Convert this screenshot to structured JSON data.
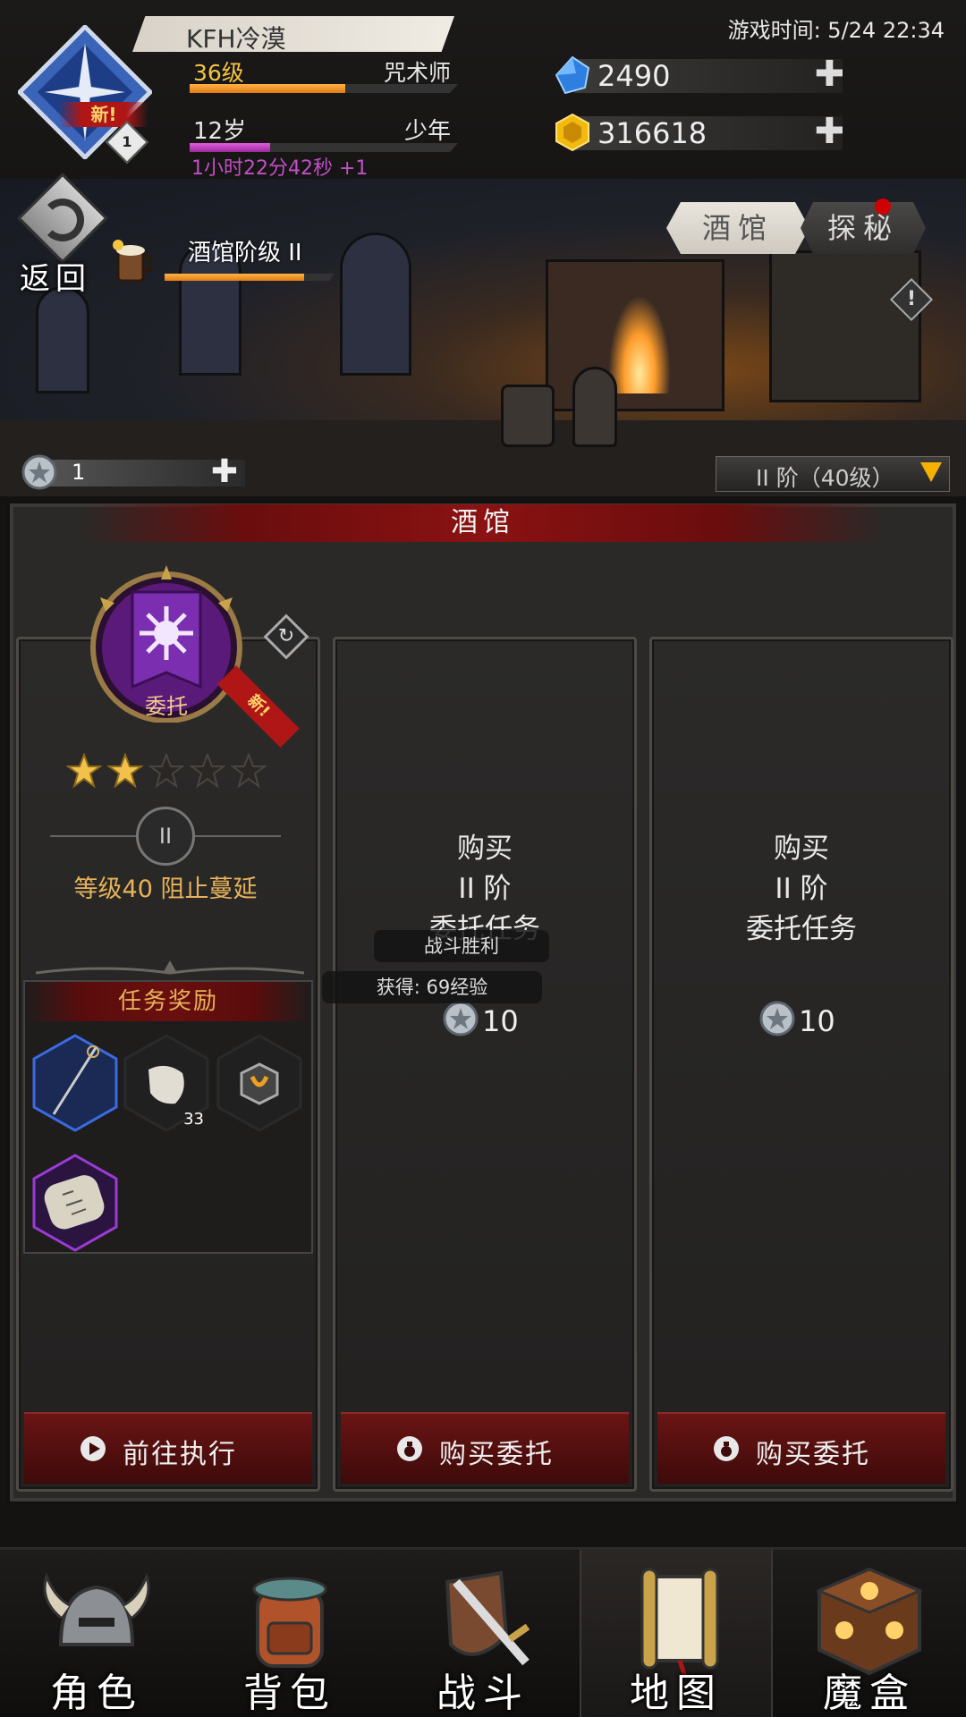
{
  "header": {
    "avatar_badge": "新!",
    "avatar_level_badge": "1",
    "player_name": "KFH冷漠",
    "level": "36级",
    "level_progress": 0.58,
    "class": "咒术师",
    "age": "12岁",
    "age_progress": 0.3,
    "life_stage": "少年",
    "age_timer": "1小时22分42秒 +1",
    "game_time": "游戏时间: 5/24 22:34",
    "gems": "2490",
    "gold": "316618",
    "plus": "✚"
  },
  "banner": {
    "back_label": "返回",
    "tavern_level_label": "酒馆阶级 II",
    "tavern_level_progress": 0.82,
    "tab_tavern": "酒馆",
    "tab_explore": "探秘",
    "info": "!",
    "ticket_count": "1",
    "tier_select": "II 阶（40级）"
  },
  "panel": {
    "title": "酒馆",
    "card1": {
      "emblem_label": "委托",
      "new_tag": "新!",
      "stars_filled": 2,
      "stars_total": 5,
      "tier_mark": "II",
      "description": "等级40 阻止蔓延",
      "reward_title": "任务奖励",
      "reward_count_cloth": "33",
      "button": "前往执行"
    },
    "card2": {
      "line1": "购买",
      "line2": "II 阶",
      "line3": "委托任务",
      "price": "10",
      "button": "购买委托"
    },
    "card3": {
      "line1": "购买",
      "line2": "II 阶",
      "line3": "委托任务",
      "price": "10",
      "button": "购买委托"
    },
    "toast_victory": "战斗胜利",
    "toast_exp": "获得: 69经验"
  },
  "nav": {
    "items": [
      {
        "label": "角色",
        "icon": "helmet-icon"
      },
      {
        "label": "背包",
        "icon": "backpack-icon"
      },
      {
        "label": "战斗",
        "icon": "sword-shield-icon"
      },
      {
        "label": "地图",
        "icon": "scroll-map-icon"
      },
      {
        "label": "魔盒",
        "icon": "magic-box-icon"
      }
    ],
    "active_index": 3
  },
  "colors": {
    "accent_red": "#8a1212",
    "gold_text": "#e7b25a",
    "level_yellow": "#f4c542",
    "timer_purple": "#c24fc8"
  }
}
